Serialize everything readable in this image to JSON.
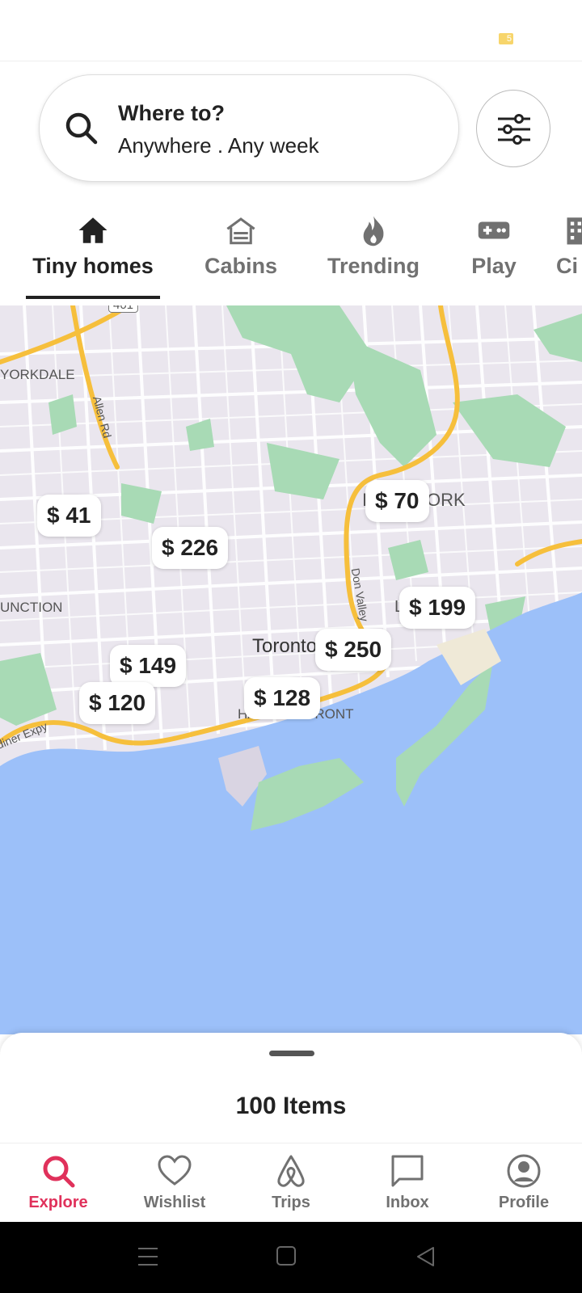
{
  "status_bar": {
    "battery": "5"
  },
  "search": {
    "title": "Where to?",
    "subtitle": "Anywhere . Any week"
  },
  "categories": [
    {
      "label": "Tiny homes",
      "icon": "house-icon",
      "active": true
    },
    {
      "label": "Cabins",
      "icon": "cabin-icon",
      "active": false
    },
    {
      "label": "Trending",
      "icon": "fire-icon",
      "active": false
    },
    {
      "label": "Play",
      "icon": "gamepad-icon",
      "active": false
    },
    {
      "label": "Ci",
      "icon": "building-icon",
      "active": false
    }
  ],
  "map": {
    "labels": {
      "highway_401": "401",
      "yorkdale": "YORKDALE",
      "allen_rd": "Allen Rd",
      "junction": "UNCTION",
      "don_valley": "Don Valley",
      "toronto": "Toronto",
      "harbourfront": "HARBOURFRONT",
      "gardiner": "diner Expy",
      "york": "ORK",
      "l_mark": "L",
      "i_mark": "I"
    },
    "prices": [
      "$ 41",
      "$ 226",
      "$ 70",
      "$ 199",
      "$ 149",
      "$ 250",
      "$ 120",
      "$ 128"
    ]
  },
  "sheet": {
    "items_label": "100 Items"
  },
  "bottom_nav": [
    {
      "label": "Explore",
      "icon": "search-icon",
      "active": true
    },
    {
      "label": "Wishlist",
      "icon": "heart-icon",
      "active": false
    },
    {
      "label": "Trips",
      "icon": "airbnb-logo-icon",
      "active": false
    },
    {
      "label": "Inbox",
      "icon": "message-icon",
      "active": false
    },
    {
      "label": "Profile",
      "icon": "user-circle-icon",
      "active": false
    }
  ],
  "colors": {
    "accent": "#e0315b",
    "water": "#9cc0f9",
    "park": "#a8dab5",
    "highway": "#f6bf3c"
  }
}
